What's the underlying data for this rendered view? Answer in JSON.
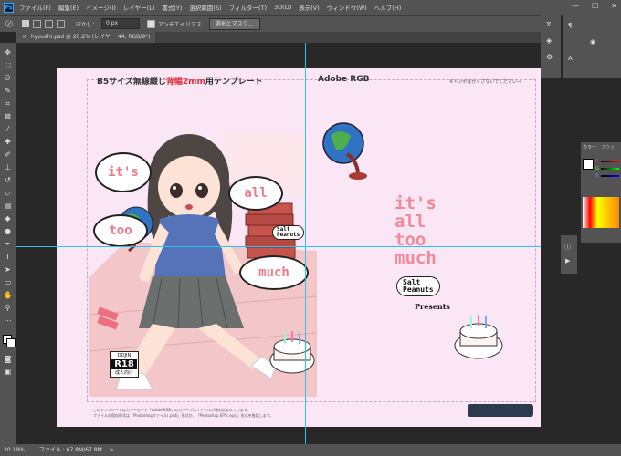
{
  "app": {
    "logo": "Ps"
  },
  "menu": [
    "ファイル(F)",
    "編集(E)",
    "イメージ(I)",
    "レイヤー(L)",
    "書式(Y)",
    "選択範囲(S)",
    "フィルター(T)",
    "3D(D)",
    "表示(V)",
    "ウィンドウ(W)",
    "ヘルプ(H)"
  ],
  "window_controls": {
    "minimize": "—",
    "maximize": "☐",
    "close": "✕"
  },
  "options": {
    "feather_label": "ぼかし：",
    "feather_value": "0 px",
    "antialias_label": "アンチエイリアス",
    "select_mask_button": "選択とマスク..."
  },
  "document_tab": {
    "title": "hyoushi.psd @ 20.2% (レイヤー 44, RGB/8*)",
    "close": "×"
  },
  "page": {
    "left_header_a": "B5サイズ無線綴じ",
    "left_header_highlight": "背幅2mm",
    "left_header_b": "用テンプレート",
    "right_header": "Adobe RGB",
    "tombo_note": "※トンボはかくさないでください→",
    "bubbles": [
      "it's",
      "all",
      "too",
      "much"
    ],
    "title_lines": [
      "it's",
      "all",
      "too",
      "much"
    ],
    "salt_peanuts": [
      "Salt",
      "Peanuts"
    ],
    "presents": "Presents",
    "r18": {
      "top": "DOJIN",
      "main": "R18",
      "sub": "成人向け",
      "small": "18歳未満の\n購入・閲覧禁止"
    },
    "notice_lines": [
      "このテンプレートはカラーモード「AdobeRGB」のカラープロファイルが埋め込まれています。",
      "ファイルの保存形式は「Photoshopファイル(.psd)」形式か、「Photoshop EPS(.eps)」形式を推奨します。"
    ]
  },
  "right_panels": {
    "color_tab": "カラー",
    "swatch_tab": "スウォ",
    "letters": [
      "R",
      "G",
      "B"
    ]
  },
  "status": {
    "zoom": "20.19%",
    "file": "ファイル : 67.8M/67.8M",
    "arrow": ">"
  },
  "colors": {
    "ui_bg": "#535353",
    "canvas_bg": "#282828",
    "doc_bg": "#fbe6f6",
    "guide": "#27c3f2",
    "title_pink": "#f28a98",
    "highlight_red": "#e0303a"
  }
}
